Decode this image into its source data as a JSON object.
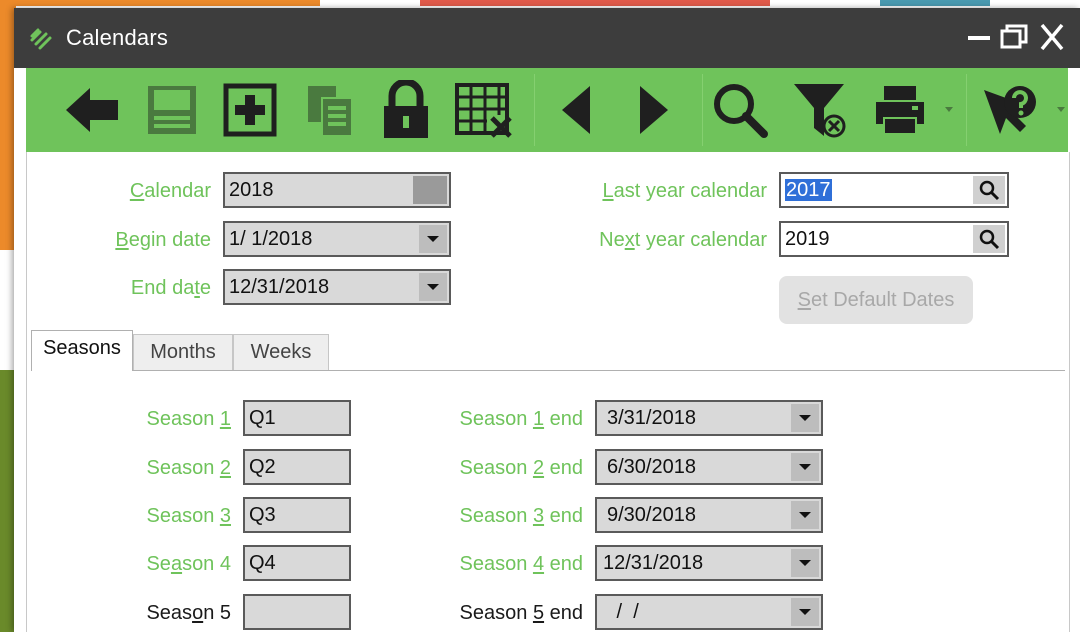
{
  "window": {
    "title": "Calendars"
  },
  "colors": {
    "accent": "#6fc35b",
    "titlebar": "#3d3d3d",
    "selection": "#2f6fd8"
  },
  "toolbar": {
    "buttons": [
      {
        "icon": "back-arrow-icon",
        "name": "back"
      },
      {
        "icon": "save-icon",
        "name": "save",
        "disabled": true
      },
      {
        "icon": "add-icon",
        "name": "add"
      },
      {
        "icon": "copy-icon",
        "name": "copy",
        "disabled": true
      },
      {
        "icon": "lock-icon",
        "name": "lock"
      },
      {
        "icon": "delete-grid-icon",
        "name": "delete"
      },
      {
        "icon": "previous-icon",
        "name": "previous"
      },
      {
        "icon": "next-icon",
        "name": "next"
      },
      {
        "icon": "search-icon",
        "name": "search"
      },
      {
        "icon": "filter-clear-icon",
        "name": "filter"
      },
      {
        "icon": "print-icon",
        "name": "print"
      },
      {
        "icon": "help-icon",
        "name": "help"
      }
    ]
  },
  "form": {
    "calendar": {
      "label_pre": "",
      "label_u": "C",
      "label_post": "alendar",
      "value": "2018"
    },
    "begin_date": {
      "label_pre": "",
      "label_u": "B",
      "label_post": "egin date",
      "value": "1/ 1/2018"
    },
    "end_date": {
      "label_pre": "End da",
      "label_u": "t",
      "label_post": "e",
      "value": "12/31/2018"
    },
    "last_year": {
      "label_pre": "",
      "label_u": "L",
      "label_post": "ast year calendar",
      "value": "2017"
    },
    "next_year": {
      "label_pre": "Ne",
      "label_u": "x",
      "label_post": "t year calendar",
      "value": "2019"
    },
    "default_button": {
      "label_pre": "",
      "label_u": "S",
      "label_post": "et Default Dates"
    }
  },
  "tabs": [
    "Seasons",
    "Months",
    "Weeks"
  ],
  "seasons": [
    {
      "label_pre": "Season ",
      "label_u": "1",
      "label_post": "",
      "value": "Q1",
      "end_pre": "Season ",
      "end_u": "1",
      "end_post": " end",
      "end_value": "3/31/2018"
    },
    {
      "label_pre": "Season ",
      "label_u": "2",
      "label_post": "",
      "value": "Q2",
      "end_pre": "Season ",
      "end_u": "2",
      "end_post": " end",
      "end_value": "6/30/2018"
    },
    {
      "label_pre": "Season ",
      "label_u": "3",
      "label_post": "",
      "value": "Q3",
      "end_pre": "Season ",
      "end_u": "3",
      "end_post": " end",
      "end_value": "9/30/2018"
    },
    {
      "label_pre": "Se",
      "label_u": "a",
      "label_post": "son 4",
      "value": "Q4",
      "end_pre": "Season ",
      "end_u": "4",
      "end_post": " end",
      "end_value": "12/31/2018"
    },
    {
      "label_pre": "Seas",
      "label_u": "o",
      "label_post": "n 5",
      "value": "",
      "end_pre": "Season ",
      "end_u": "5",
      "end_post": " end",
      "end_value": " /  /"
    }
  ]
}
